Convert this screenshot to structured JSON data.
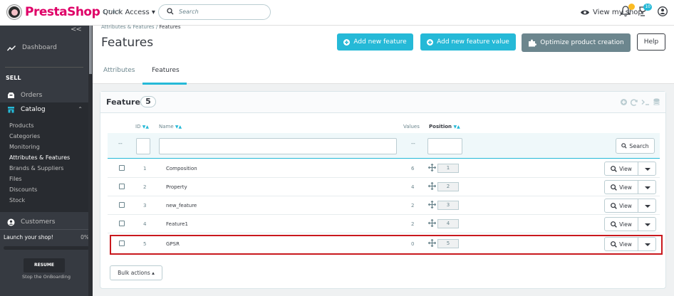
{
  "header": {
    "logo_text": "PrestaShop",
    "version": "1.7.8.7",
    "quick_access": "Quick Access ▾",
    "search_placeholder": "Search",
    "view_shop": "View my shop",
    "notif_badge_1": "",
    "notif_badge_2": "10"
  },
  "sidebar": {
    "collapse": "<<",
    "dashboard": "Dashboard",
    "section_sell": "SELL",
    "orders": "Orders",
    "catalog": "Catalog",
    "catalog_items": [
      "Products",
      "Categories",
      "Monitoring",
      "Attributes & Features",
      "Brands & Suppliers",
      "Files",
      "Discounts",
      "Stock"
    ],
    "customers": "Customers",
    "onboarding_label": "Launch your shop!",
    "onboarding_percent": "0%",
    "resume": "RESUME",
    "stop": "Stop the OnBoarding"
  },
  "page": {
    "breadcrumb_parent": "Attributes & Features",
    "breadcrumb_sep": "/",
    "breadcrumb_current": "Features",
    "title": "Features",
    "btn_add_feature": "Add new feature",
    "btn_add_value": "Add new feature value",
    "btn_optimize": "Optimize product creation",
    "btn_help": "Help",
    "tabs": [
      "Attributes",
      "Features"
    ]
  },
  "panel": {
    "title": "Features",
    "count": "5",
    "columns": {
      "id": "ID",
      "name": "Name",
      "values": "Values",
      "position": "Position"
    },
    "filter_dash": "--",
    "search_button": "Search",
    "view_label": "View",
    "bulk_actions": "Bulk actions ▴",
    "rows": [
      {
        "id": "1",
        "name": "Composition",
        "values": "6",
        "position": "1"
      },
      {
        "id": "2",
        "name": "Property",
        "values": "4",
        "position": "2"
      },
      {
        "id": "3",
        "name": "new_feature",
        "values": "2",
        "position": "3"
      },
      {
        "id": "4",
        "name": "Feature1",
        "values": "2",
        "position": "4"
      },
      {
        "id": "5",
        "name": "GPSR",
        "values": "0",
        "position": "5"
      }
    ]
  },
  "colors": {
    "accent": "#25b9d7",
    "brand": "#df0067",
    "highlight": "#c9191e",
    "sidebar": "#363a41"
  }
}
